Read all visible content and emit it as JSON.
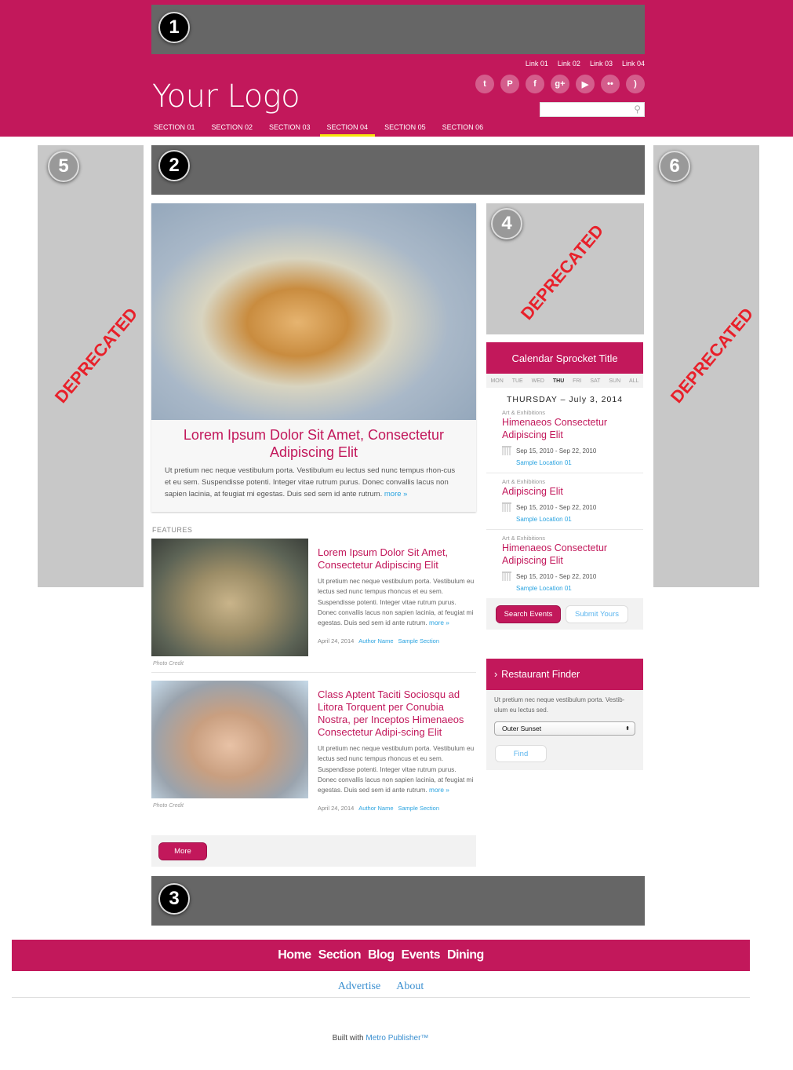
{
  "colors": {
    "brand": "#c2185b",
    "link": "#29a3e0",
    "nav_active": "#f5e50a",
    "placeholder": "#666666"
  },
  "placeholders": {
    "p1": "1",
    "p2": "2",
    "p3": "3",
    "p4": "4",
    "p5": "5",
    "p6": "6",
    "deprecated": "DEPRECATED"
  },
  "header": {
    "top_links": [
      "Link 01",
      "Link 02",
      "Link 03",
      "Link 04"
    ],
    "social_icons": [
      "twitter-icon",
      "pinterest-icon",
      "facebook-icon",
      "google-plus-icon",
      "youtube-icon",
      "flickr-icon",
      "rss-icon"
    ],
    "logo": "Your Logo",
    "search": {
      "value": "",
      "placeholder": ""
    },
    "nav": [
      "SECTION 01",
      "SECTION 02",
      "SECTION 03",
      "SECTION 04",
      "SECTION 05",
      "SECTION 06"
    ],
    "active_nav": "SECTION 04"
  },
  "hero": {
    "title": "Lorem Ipsum Dolor Sit Amet, Consectetur Adipiscing Elit",
    "text": "Ut pretium nec neque vestibulum porta. Vestibulum eu lectus sed nunc tempus rhon-cus et eu sem. Suspendisse potenti. Integer vitae rutrum purus. Donec convallis lacus non sapien lacinia, at feugiat mi egestas. Duis sed sem id ante rutrum.",
    "more": "more »"
  },
  "features": {
    "label": "FEATURES",
    "items": [
      {
        "title": "Lorem Ipsum Dolor Sit Amet, Consectetur Adipiscing Elit",
        "text": "Ut pretium nec neque vestibulum porta. Vestibulum eu lectus sed nunc tempus rhoncus et eu sem. Suspendisse potenti. Integer vitae rutrum purus. Donec convallis lacus non sapien lacinia, at feugiat mi egestas. Duis sed sem id ante rutrum.",
        "more": "more »",
        "date": "April 24, 2014",
        "author": "Author Name",
        "section": "Sample Section",
        "credit": "Photo Credit"
      },
      {
        "title": "Class Aptent Taciti Sociosqu ad Litora Torquent per Conubia Nostra, per Inceptos Himenaeos Consectetur Adipi-scing Elit",
        "text": "Ut pretium nec neque vestibulum porta. Vestibulum eu lectus sed nunc tempus rhoncus et eu sem. Suspendisse potenti. Integer vitae rutrum purus. Donec convallis lacus non sapien lacinia, at feugiat mi egestas. Duis sed sem id ante rutrum.",
        "more": "more »",
        "date": "April 24, 2014",
        "author": "Author Name",
        "section": "Sample Section",
        "credit": "Photo Credit"
      }
    ],
    "more_button": "More"
  },
  "calendar": {
    "title": "Calendar Sprocket Title",
    "days": [
      "MON",
      "TUE",
      "WED",
      "THU",
      "FRI",
      "SAT",
      "SUN",
      "ALL"
    ],
    "active_day": "THU",
    "date": "THURSDAY – July 3, 2014",
    "events": [
      {
        "category": "Art & Exhibitions",
        "title": "Himenaeos Consectetur Adipiscing Elit",
        "dates": "Sep 15, 2010 - Sep 22, 2010",
        "location": "Sample Location 01"
      },
      {
        "category": "Art & Exhibitions",
        "title": "Adipiscing Elit",
        "dates": "Sep 15, 2010 - Sep 22, 2010",
        "location": "Sample Location 01"
      },
      {
        "category": "Art & Exhibitions",
        "title": "Himenaeos Consectetur Adipiscing Elit",
        "dates": "Sep 15, 2010 - Sep 22, 2010",
        "location": "Sample Location 01"
      }
    ],
    "search_button": "Search Events",
    "submit_button": "Submit Yours"
  },
  "restaurant": {
    "title": "Restaurant Finder",
    "text": "Ut pretium nec neque vestibulum porta. Vestib-ulum eu lectus sed.",
    "selected": "Outer Sunset",
    "find_button": "Find"
  },
  "footer": {
    "nav": [
      "Home",
      "Section",
      "Blog",
      "Events",
      "Dining"
    ],
    "links": [
      "Advertise",
      "About"
    ],
    "built_prefix": "Built with ",
    "built_link": "Metro Publisher™"
  }
}
